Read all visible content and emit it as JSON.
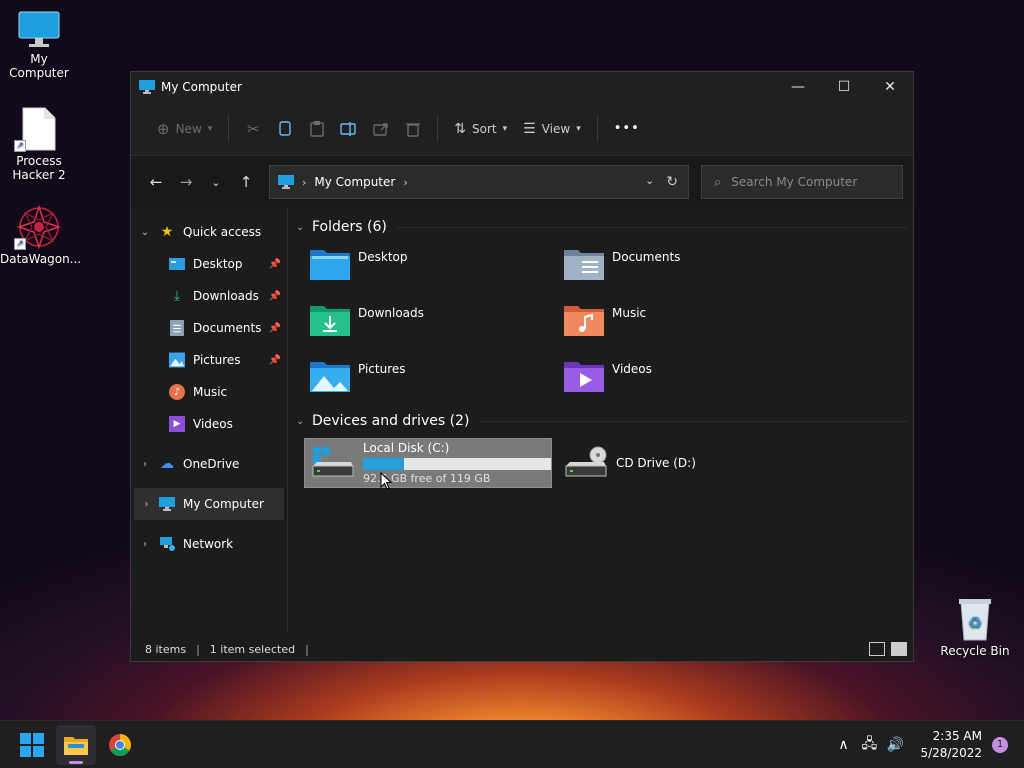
{
  "desktop": {
    "icons": [
      {
        "label": "My Computer"
      },
      {
        "label": "Process Hacker 2"
      },
      {
        "label": "DataWagon..."
      },
      {
        "label": "Recycle Bin"
      }
    ]
  },
  "window": {
    "title": "My Computer",
    "controls": {
      "minimize": "—",
      "maximize": "☐",
      "close": "✕"
    }
  },
  "toolbar": {
    "new_label": "New",
    "sort_label": "Sort",
    "view_label": "View",
    "more_label": "•••"
  },
  "navbar": {
    "address_path": "My Computer",
    "search_placeholder": "Search My Computer"
  },
  "sidebar": {
    "quick_access": "Quick access",
    "quick_items": [
      {
        "label": "Desktop",
        "pinned": true
      },
      {
        "label": "Downloads",
        "pinned": true
      },
      {
        "label": "Documents",
        "pinned": true
      },
      {
        "label": "Pictures",
        "pinned": true
      },
      {
        "label": "Music",
        "pinned": false
      },
      {
        "label": "Videos",
        "pinned": false
      }
    ],
    "onedrive": "OneDrive",
    "my_computer": "My Computer",
    "network": "Network"
  },
  "content": {
    "folders_header": "Folders (6)",
    "folders": [
      {
        "label": "Desktop"
      },
      {
        "label": "Documents"
      },
      {
        "label": "Downloads"
      },
      {
        "label": "Music"
      },
      {
        "label": "Pictures"
      },
      {
        "label": "Videos"
      }
    ],
    "drives_header": "Devices and drives (2)",
    "drives": [
      {
        "label": "Local Disk (C:)",
        "free_text": "92.5 GB free of 119 GB",
        "used_fraction": 0.22
      },
      {
        "label": "CD Drive (D:)"
      }
    ]
  },
  "statusbar": {
    "items_count": "8 items",
    "selected": "1 item selected"
  },
  "taskbar": {
    "time": "2:35 AM",
    "date": "5/28/2022",
    "notifications": "1"
  },
  "colors": {
    "accent": "#26a0da",
    "window_bg": "#1c1c1c",
    "taskbar_bg": "#1f1f22"
  }
}
